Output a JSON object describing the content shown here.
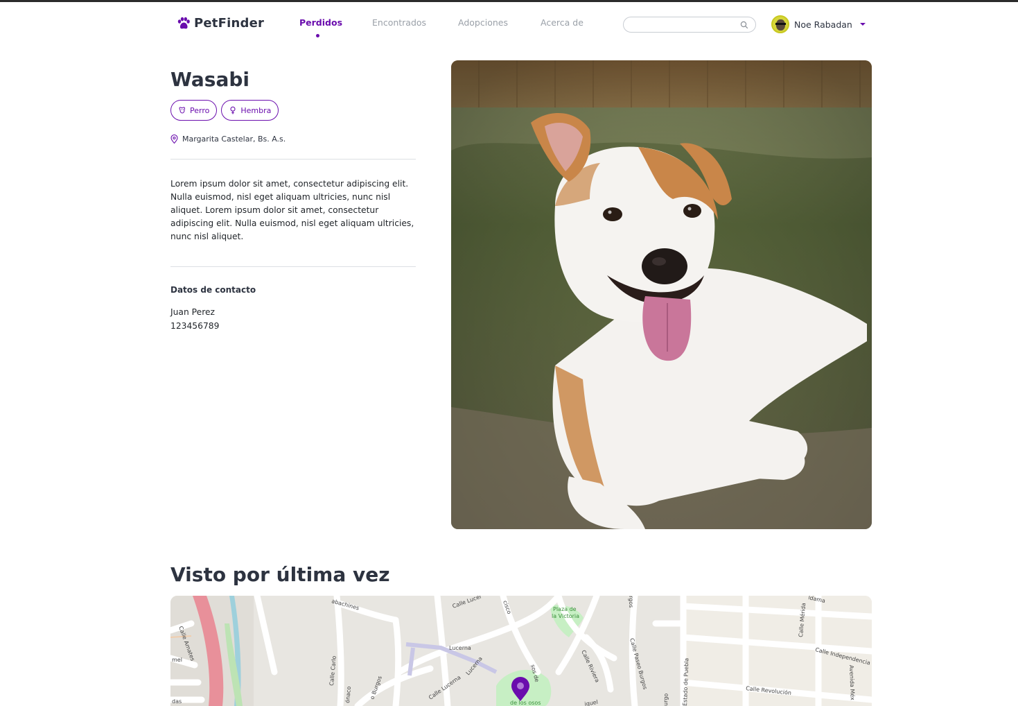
{
  "brand": {
    "name": "PetFinder",
    "accent": "#6a0dad"
  },
  "nav": {
    "items": [
      {
        "label": "Perdidos",
        "active": true
      },
      {
        "label": "Encontrados",
        "active": false
      },
      {
        "label": "Adopciones",
        "active": false
      },
      {
        "label": "Acerca de",
        "active": false
      }
    ]
  },
  "search": {
    "value": "",
    "icon": "search-icon"
  },
  "user": {
    "name": "Noe Rabadan",
    "icon": "chevron-down-icon"
  },
  "pet": {
    "name": "Wasabi",
    "tags": [
      {
        "label": "Perro",
        "icon": "dog-icon"
      },
      {
        "label": "Hembra",
        "icon": "female-icon"
      }
    ],
    "location": "Margarita Castelar, Bs. A.s.",
    "description": "Lorem ipsum dolor sit amet, consectetur adipiscing elit. Nulla euismod, nisl eget aliquam ultricies, nunc nisl aliquet. Lorem ipsum dolor sit amet, consectetur adipiscing elit. Nulla euismod, nisl eget aliquam ultricies, nunc nisl aliquet."
  },
  "contact": {
    "title": "Datos de contacto",
    "name": "Juan Perez",
    "phone": "123456789"
  },
  "map_section": {
    "title": "Visto por última vez",
    "labels": {
      "calle_amates": "Calle Amates",
      "mel": "mel",
      "das": "das",
      "abachines": "abachines",
      "calle_lucerna_top": "Calle Lucer",
      "cisco": "cisco",
      "plaza": "Plaza de",
      "plaza2": "la Victoria",
      "burgos": "rgos",
      "lucerna": "Lucerna",
      "lucerna2": "Lucerna",
      "calle_lucerna": "Calle Lucerna",
      "calle_riviera": "Calle Riviera",
      "calle_paseo_burgos": "Calle Paseo Burgos",
      "calle_carlo": "Calle Carlo",
      "onaco": "ónaco",
      "paseo_burgos": "o Burgos",
      "osos": "sos de",
      "de_los_osos": "de los osos",
      "calle_merida": "Calle Mérida",
      "calle_independencia": "Calle Independencia",
      "avenida_mexico": "Avenida Méx",
      "calle_revolucion": "Calle Revolución",
      "estado_puebla": "Estado de Puebla",
      "idama": "ldama",
      "urgo": "urgo",
      "iguel": "iguel"
    }
  }
}
